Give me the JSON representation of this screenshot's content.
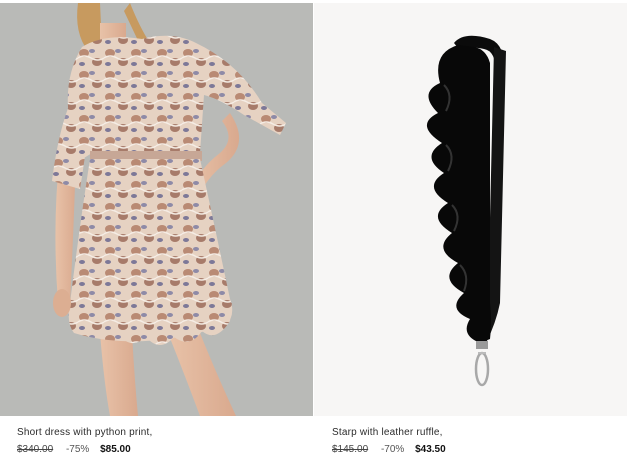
{
  "products": [
    {
      "title": "Short dress with python print,",
      "old_price": "$340.00",
      "discount": "-75%",
      "new_price": "$85.00",
      "image_icon": "dress-photo"
    },
    {
      "title": "Starp with leather ruffle,",
      "old_price": "$145.00",
      "discount": "-70%",
      "new_price": "$43.50",
      "image_icon": "strap-photo"
    }
  ]
}
